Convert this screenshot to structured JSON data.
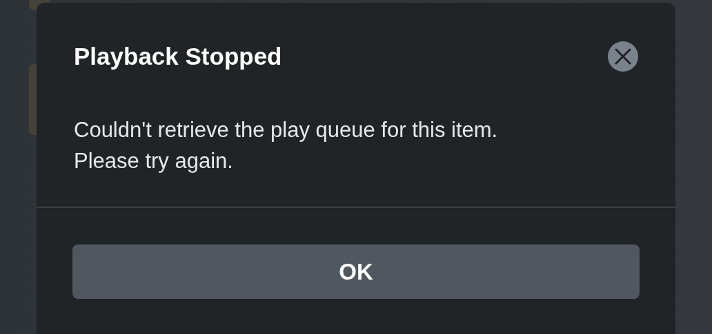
{
  "dialog": {
    "title": "Playback Stopped",
    "message": "Couldn't retrieve the play queue for this item.\nPlease try again.",
    "buttons": [
      {
        "label": "OK"
      }
    ]
  }
}
